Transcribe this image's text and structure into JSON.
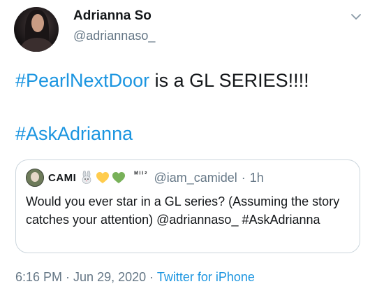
{
  "author": {
    "display_name": "Adrianna So",
    "handle": "@adriannaso_"
  },
  "tweet": {
    "hashtag1": "#PearlNextDoor",
    "text_rest": " is a GL SERIES!!!!",
    "hashtag2": "#AskAdrianna"
  },
  "quoted": {
    "name": "CAMI",
    "tag": "ᴹᴵᴵ²",
    "handle": "@iam_camidel",
    "separator": "·",
    "time": "1h",
    "text": "Would you ever star in a GL series? (Assuming the story catches your attention) @adriannaso_ #AskAdrianna"
  },
  "meta": {
    "time": "6:16 PM",
    "sep1": " · ",
    "date": "Jun 29, 2020",
    "sep2": " · ",
    "source": "Twitter for iPhone"
  },
  "icons": {
    "menu": "chevron-down-icon",
    "rabbit": "rabbit-emoji",
    "yellow_heart": "yellow-heart-emoji",
    "green_heart": "green-heart-emoji"
  },
  "colors": {
    "link": "#1b95e0",
    "secondary": "#657786",
    "border": "#ccd6dd",
    "yellow_heart": "#ffcc4d",
    "green_heart": "#78b159"
  }
}
